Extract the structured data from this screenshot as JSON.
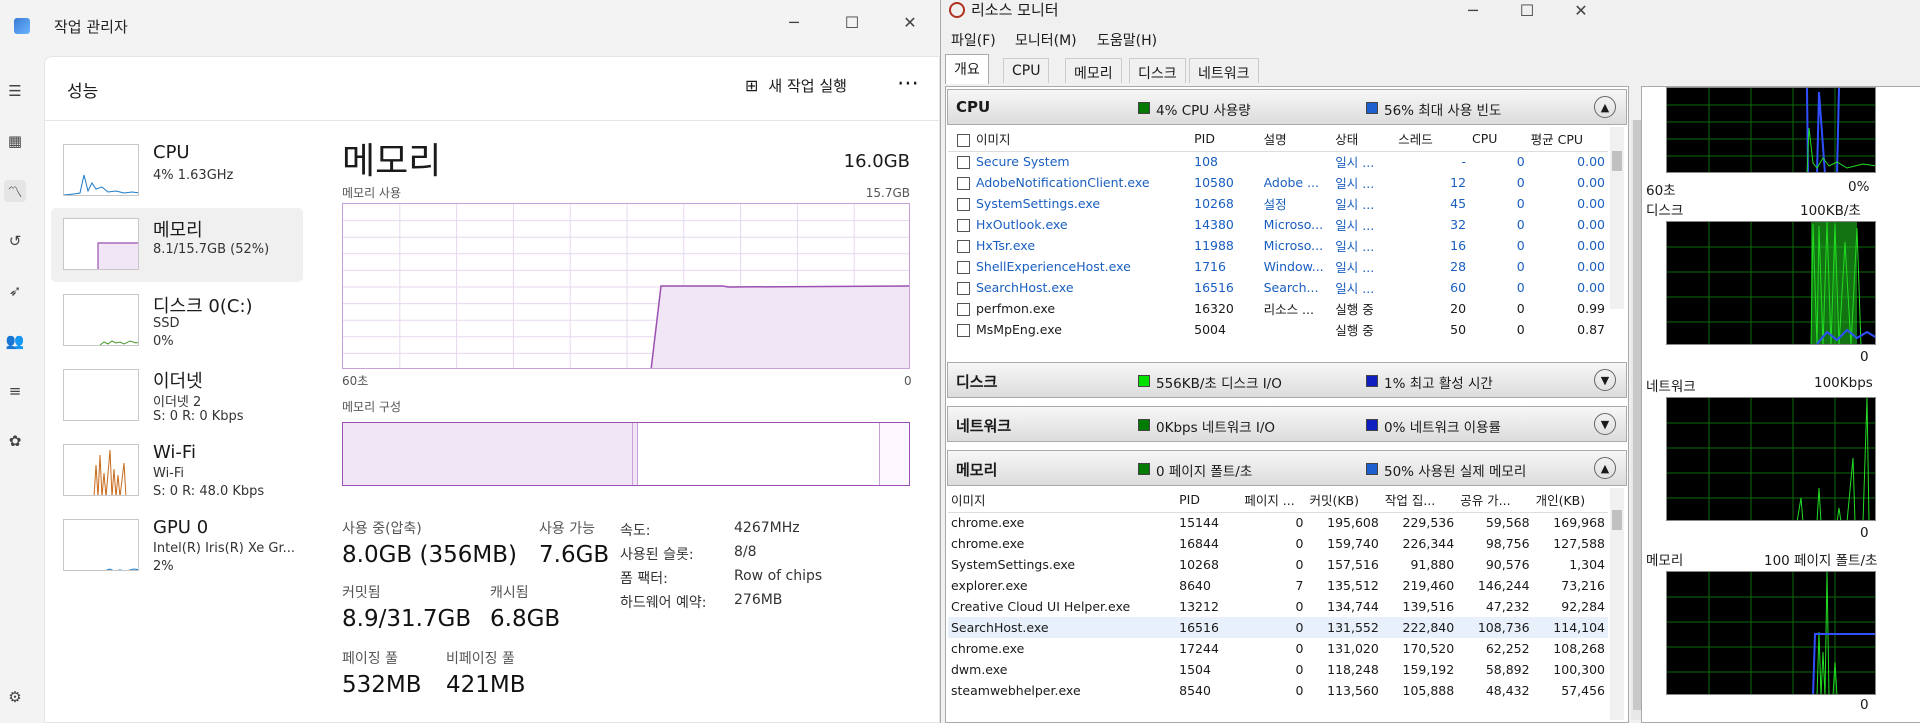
{
  "task_manager": {
    "title": "작업 관리자",
    "window_controls": {
      "min": "─",
      "max": "☐",
      "close": "✕"
    },
    "section_title": "성능",
    "new_task": "새 작업 실행",
    "more": "⋯",
    "items": [
      {
        "name": "CPU",
        "line1": "4%  1.63GHz",
        "line2": ""
      },
      {
        "name": "메모리",
        "line1": "8.1/15.7GB (52%)",
        "line2": ""
      },
      {
        "name": "디스크 0(C:)",
        "line1": "SSD",
        "line2": "0%"
      },
      {
        "name": "이더넷",
        "line1": "이더넷 2",
        "line2": "S: 0  R: 0 Kbps"
      },
      {
        "name": "Wi-Fi",
        "line1": "Wi-Fi",
        "line2": "S: 0  R: 48.0 Kbps"
      },
      {
        "name": "GPU 0",
        "line1": "Intel(R) Iris(R) Xe Gr...",
        "line2": "2%"
      }
    ],
    "memory": {
      "heading": "메모리",
      "total": "16.0GB",
      "usage_label": "메모리 사용",
      "usage_max": "15.7GB",
      "x_left": "60초",
      "x_right": "0",
      "composition_label": "메모리 구성",
      "in_use_label": "사용 중(압축)",
      "in_use_value": "8.0GB (356MB)",
      "available_label": "사용 가능",
      "available_value": "7.6GB",
      "committed_label": "커밋됨",
      "committed_value": "8.9/31.7GB",
      "cached_label": "캐시됨",
      "cached_value": "6.8GB",
      "paged_label": "페이징 풀",
      "paged_value": "532MB",
      "nonpaged_label": "비페이징 풀",
      "nonpaged_value": "421MB",
      "details": [
        {
          "k": "속도:",
          "v": "4267MHz"
        },
        {
          "k": "사용된 슬롯:",
          "v": "8/8"
        },
        {
          "k": "폼 팩터:",
          "v": "Row of chips"
        },
        {
          "k": "하드웨어 예약:",
          "v": "276MB"
        }
      ]
    },
    "settings_icon": "gear-icon"
  },
  "resource_monitor": {
    "title": "리소스 모니터",
    "window_controls": {
      "min": "─",
      "max": "☐",
      "close": "✕"
    },
    "menus": [
      "파일(F)",
      "모니터(M)",
      "도움말(H)"
    ],
    "tabs": [
      "개요",
      "CPU",
      "메모리",
      "디스크",
      "네트워크"
    ],
    "cpu_section": {
      "name": "CPU",
      "info1": "4% CPU 사용량",
      "info2": "56% 최대 사용 빈도",
      "color1": "#007a00",
      "color2": "#1e5fd0"
    },
    "cpu_columns": [
      "이미지",
      "PID",
      "설명",
      "상태",
      "스레드",
      "CPU",
      "평균 CPU"
    ],
    "cpu_rows": [
      [
        "Secure System",
        "108",
        "",
        "일시 ...",
        "-",
        "0",
        "0.00"
      ],
      [
        "AdobeNotificationClient.exe",
        "10580",
        "Adobe ...",
        "일시 ...",
        "12",
        "0",
        "0.00"
      ],
      [
        "SystemSettings.exe",
        "10268",
        "설정",
        "일시 ...",
        "45",
        "0",
        "0.00"
      ],
      [
        "HxOutlook.exe",
        "14380",
        "Microso...",
        "일시 ...",
        "32",
        "0",
        "0.00"
      ],
      [
        "HxTsr.exe",
        "11988",
        "Microso...",
        "일시 ...",
        "16",
        "0",
        "0.00"
      ],
      [
        "ShellExperienceHost.exe",
        "1716",
        "Window...",
        "일시 ...",
        "28",
        "0",
        "0.00"
      ],
      [
        "SearchHost.exe",
        "16516",
        "Search...",
        "일시 ...",
        "60",
        "0",
        "0.00"
      ],
      [
        "perfmon.exe",
        "16320",
        "리소스 ...",
        "실행 중",
        "20",
        "0",
        "0.99"
      ],
      [
        "MsMpEng.exe",
        "5004",
        "",
        "실행 중",
        "50",
        "0",
        "0.87"
      ]
    ],
    "disk_section": {
      "name": "디스크",
      "info1": "556KB/초 디스크 I/O",
      "info2": "1% 최고 활성 시간",
      "color1": "#00e000",
      "color2": "#1020c0"
    },
    "net_section": {
      "name": "네트워크",
      "info1": "0Kbps 네트워크 I/O",
      "info2": "0% 네트워크 이용률",
      "color1": "#007a00",
      "color2": "#1020c0"
    },
    "mem_section": {
      "name": "메모리",
      "info1": "0 페이지 폴트/초",
      "info2": "50% 사용된 실제 메모리",
      "color1": "#007a00",
      "color2": "#1e5fd0"
    },
    "mem_columns": [
      "이미지",
      "PID",
      "페이지 ...",
      "커밋(KB)",
      "작업 집...",
      "공유 가...",
      "개인(KB)"
    ],
    "mem_rows": [
      [
        "chrome.exe",
        "15144",
        "0",
        "195,608",
        "229,536",
        "59,568",
        "169,968"
      ],
      [
        "chrome.exe",
        "16844",
        "0",
        "159,740",
        "226,344",
        "98,756",
        "127,588"
      ],
      [
        "SystemSettings.exe",
        "10268",
        "0",
        "157,516",
        "91,880",
        "90,576",
        "1,304"
      ],
      [
        "explorer.exe",
        "8640",
        "7",
        "135,512",
        "219,460",
        "146,244",
        "73,216"
      ],
      [
        "Creative Cloud UI Helper.exe",
        "13212",
        "0",
        "134,744",
        "139,516",
        "47,232",
        "92,284"
      ],
      [
        "SearchHost.exe",
        "16516",
        "0",
        "131,552",
        "222,840",
        "108,736",
        "114,104"
      ],
      [
        "chrome.exe",
        "17244",
        "0",
        "131,020",
        "170,520",
        "62,252",
        "108,268"
      ],
      [
        "dwm.exe",
        "1504",
        "0",
        "118,248",
        "159,192",
        "58,892",
        "100,300"
      ],
      [
        "steamwebhelper.exe",
        "8540",
        "0",
        "113,560",
        "105,888",
        "48,432",
        "57,456"
      ]
    ],
    "graphs": [
      {
        "label": "",
        "scale": "",
        "left": "60초",
        "right": "0%"
      },
      {
        "label": "디스크",
        "scale": "100KB/초",
        "left": "",
        "right": "0"
      },
      {
        "label": "네트워크",
        "scale": "100Kbps",
        "left": "",
        "right": "0"
      },
      {
        "label": "메모리",
        "scale": "100 페이지 폴트/초",
        "left": "",
        "right": "0"
      }
    ]
  }
}
